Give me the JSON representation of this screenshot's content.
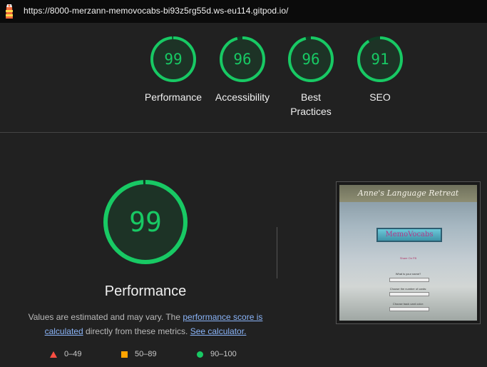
{
  "header": {
    "url": "https://8000-merzann-memovocabs-bi93z5rg55d.ws-eu114.gitpod.io/"
  },
  "colors": {
    "pass": "#18c964",
    "average": "#ffa400",
    "fail": "#ff4e42",
    "background": "#212121"
  },
  "categories": [
    {
      "label": "Performance",
      "score": "99",
      "score_value": 99
    },
    {
      "label": "Accessibility",
      "score": "96",
      "score_value": 96
    },
    {
      "label": "Best Practices",
      "score": "96",
      "score_value": 96
    },
    {
      "label": "SEO",
      "score": "91",
      "score_value": 91
    }
  ],
  "main": {
    "score": "99",
    "score_value": 99,
    "title": "Performance",
    "desc_prefix": "Values are estimated and may vary. The ",
    "desc_link": "performance score is calculated",
    "desc_middle": " directly from these metrics. ",
    "desc_calc": "See calculator."
  },
  "legend": [
    {
      "icon": "triangle-icon",
      "range": "0–49"
    },
    {
      "icon": "square-icon",
      "range": "50–89"
    },
    {
      "icon": "circle-icon",
      "range": "90–100"
    }
  ],
  "thumbnail": {
    "header": "Anne's Language Retreat",
    "logo": "MemoVocabs",
    "small_line": "Share On FB",
    "name_label": "What is your name?",
    "cards_label": "Choose the number of cards:",
    "color_label": "Choose back card color:"
  }
}
